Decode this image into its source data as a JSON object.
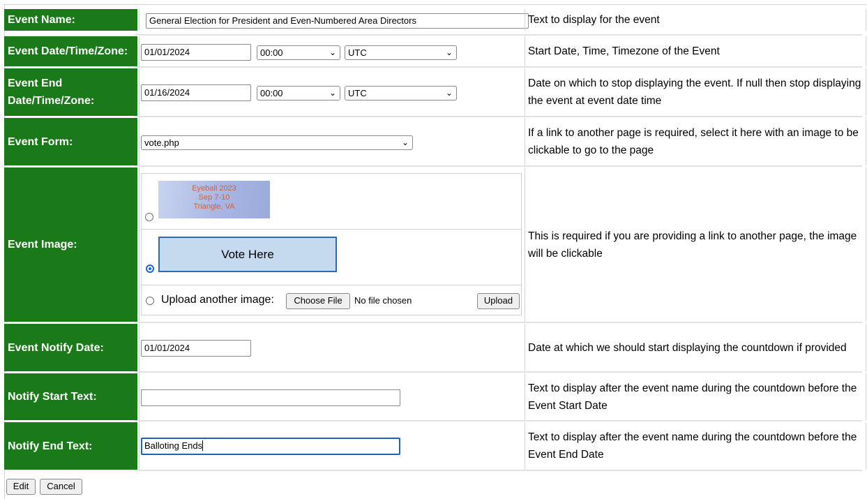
{
  "form": {
    "event_name": {
      "label": "Event Name:",
      "value": "General Election for President and Even-Numbered Area Directors",
      "desc": "Text to display for the event"
    },
    "event_date": {
      "label": "Event Date/Time/Zone:",
      "date": "01/01/2024",
      "time": "00:00",
      "zone": "UTC",
      "desc": "Start Date, Time, Timezone of the Event"
    },
    "event_end": {
      "label_line1": "Event End",
      "label_line2": "Date/Time/Zone:",
      "date": "01/16/2024",
      "time": "00:00",
      "zone": "UTC",
      "desc": "Date on which to stop displaying the event. If null then stop displaying the event at event date time"
    },
    "event_form": {
      "label": "Event Form:",
      "value": "vote.php",
      "desc": "If a link to another page is required, select it here with an image to be clickable to go to the page"
    },
    "event_image": {
      "label": "Event Image:",
      "option1_lines": [
        "Eyeball 2023",
        "Sep 7-10",
        "Triangle, VA"
      ],
      "option2_text": "Vote Here",
      "selected": 2,
      "upload_label": "Upload another image:",
      "choose_file": "Choose File",
      "no_file": "No file chosen",
      "upload_button": "Upload",
      "desc": "This is required if you are providing a link to another page, the image will be clickable"
    },
    "notify_date": {
      "label": "Event Notify Date:",
      "value": "01/01/2024",
      "desc": "Date at which we should start displaying the countdown if provided"
    },
    "notify_start": {
      "label": "Notify Start Text:",
      "value": "",
      "desc": "Text to display after the event name during the countdown before the Event Start Date"
    },
    "notify_end": {
      "label": "Notify End Text:",
      "value": "Balloting Ends",
      "desc": "Text to display after the event name during the countdown before the Event End Date"
    }
  },
  "actions": {
    "edit": "Edit",
    "cancel": "Cancel"
  },
  "colors": {
    "label_bg": "#1a7a1a",
    "focus": "#1f5fbf",
    "radio": "#1565e0"
  }
}
